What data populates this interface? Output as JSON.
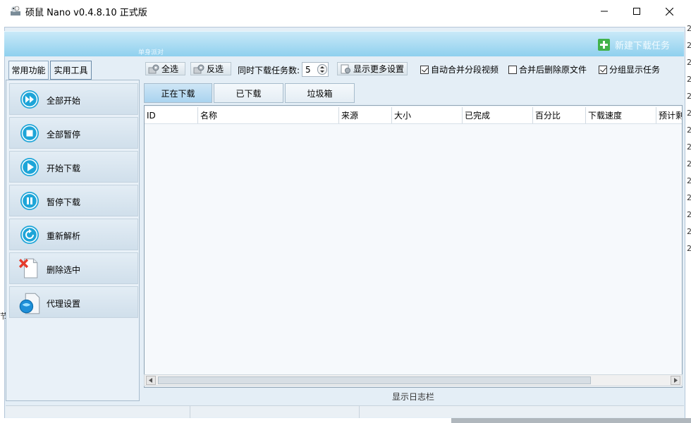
{
  "window": {
    "title": "硕鼠 Nano v0.4.8.10 正式版"
  },
  "banner": {
    "subtitle": "单身派对",
    "new_task_label": "新建下载任务"
  },
  "side_tabs": [
    "常用功能",
    "实用工具"
  ],
  "sidebar": {
    "items": [
      {
        "label": "全部开始",
        "icon": "fast-forward-icon"
      },
      {
        "label": "全部暂停",
        "icon": "stop-icon"
      },
      {
        "label": "开始下载",
        "icon": "play-icon"
      },
      {
        "label": "暂停下载",
        "icon": "pause-icon"
      },
      {
        "label": "重新解析",
        "icon": "refresh-icon"
      },
      {
        "label": "删除选中",
        "icon": "delete-icon"
      },
      {
        "label": "代理设置",
        "icon": "proxy-icon"
      }
    ]
  },
  "toolbar": {
    "select_all": "全选",
    "invert": "反选",
    "concurrent_label": "同时下载任务数:",
    "concurrent_value": "5",
    "more_settings": "显示更多设置",
    "opt_merge": "自动合并分段视频",
    "opt_delete": "合并后删除原文件",
    "opt_group": "分组显示任务",
    "opt_merge_checked": true,
    "opt_delete_checked": false,
    "opt_group_checked": true
  },
  "main_tabs": [
    "正在下载",
    "已下载",
    "垃圾箱"
  ],
  "grid": {
    "columns": [
      "ID",
      "名称",
      "来源",
      "大小",
      "已完成",
      "百分比",
      "下载速度",
      "预计剩余"
    ]
  },
  "log_bar": "显示日志栏",
  "edge_text": {
    "right_char": "2",
    "left_char": "节"
  },
  "colors": {
    "accent": "#8fd0ee",
    "active_tab": "#a9d3ef",
    "icon_blue": "#1ea5d8"
  }
}
